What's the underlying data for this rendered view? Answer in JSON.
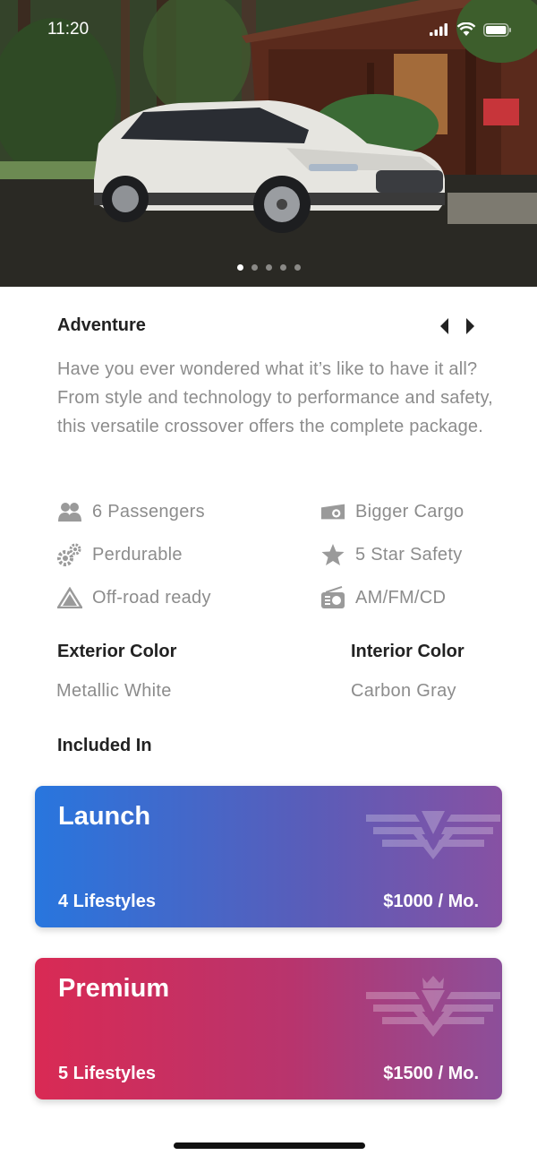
{
  "status_bar": {
    "time": "11:20"
  },
  "hero": {
    "slide_count": 5,
    "active_slide": 1
  },
  "vehicle": {
    "title": "Adventure",
    "description": "Have you ever wondered what it’s like to have it all? From style and technology to performance and safety, this versatile crossover offers the complete package."
  },
  "features": [
    {
      "icon": "passengers-icon",
      "label": "6 Passengers"
    },
    {
      "icon": "cargo-icon",
      "label": "Bigger Cargo"
    },
    {
      "icon": "gears-icon",
      "label": "Perdurable"
    },
    {
      "icon": "star-icon",
      "label": "5 Star Safety"
    },
    {
      "icon": "mountain-icon",
      "label": "Off-road ready"
    },
    {
      "icon": "radio-icon",
      "label": "AM/FM/CD"
    }
  ],
  "colors": {
    "exterior_label": "Exterior Color",
    "exterior_value": "Metallic White",
    "interior_label": "Interior Color",
    "interior_value": "Carbon Gray"
  },
  "included": {
    "heading": "Included In",
    "plans": [
      {
        "name": "Launch",
        "lifestyles": "4 Lifestyles",
        "price": "$1000 / Mo.",
        "gradient": [
          "#2876de",
          "#8751a3"
        ]
      },
      {
        "name": "Premium",
        "lifestyles": "5 Lifestyles",
        "price": "$1500 / Mo.",
        "gradient": [
          "#d92a54",
          "#8c4f9a"
        ]
      }
    ]
  }
}
